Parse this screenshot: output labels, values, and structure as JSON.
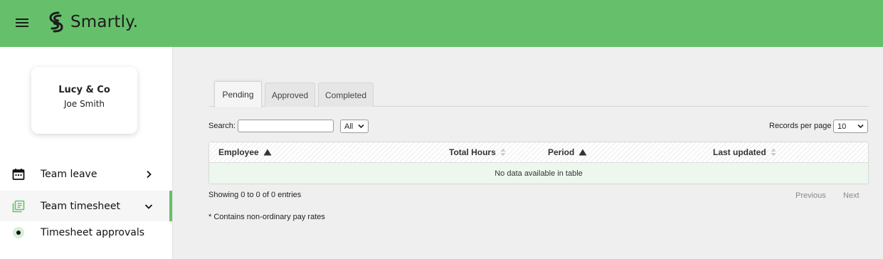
{
  "header": {
    "brand": "Smartly."
  },
  "sidebar": {
    "company": "Lucy & Co",
    "user": "Joe Smith",
    "items": [
      {
        "label": "Team leave",
        "icon": "calendar-icon"
      },
      {
        "label": "Team timesheet",
        "icon": "timesheet-icon"
      },
      {
        "label": "Timesheet approvals",
        "icon": "dot-icon"
      }
    ]
  },
  "tabs": [
    "Pending",
    "Approved",
    "Completed"
  ],
  "active_tab": "Pending",
  "controls": {
    "search_label": "Search:",
    "search_value": "",
    "filter_selected": "All",
    "records_label": "Records per page",
    "records_selected": "10"
  },
  "table": {
    "columns": [
      "Employee",
      "Total Hours",
      "Period",
      "Last updated"
    ],
    "empty_message": "No data available in table"
  },
  "footer": {
    "info": "Showing 0 to 0 of 0 entries",
    "previous": "Previous",
    "next": "Next",
    "note": "* Contains non-ordinary pay rates"
  },
  "colors": {
    "brand_green": "#66c06b",
    "row_highlight": "#edf7ee",
    "page_background": "#efefef"
  }
}
